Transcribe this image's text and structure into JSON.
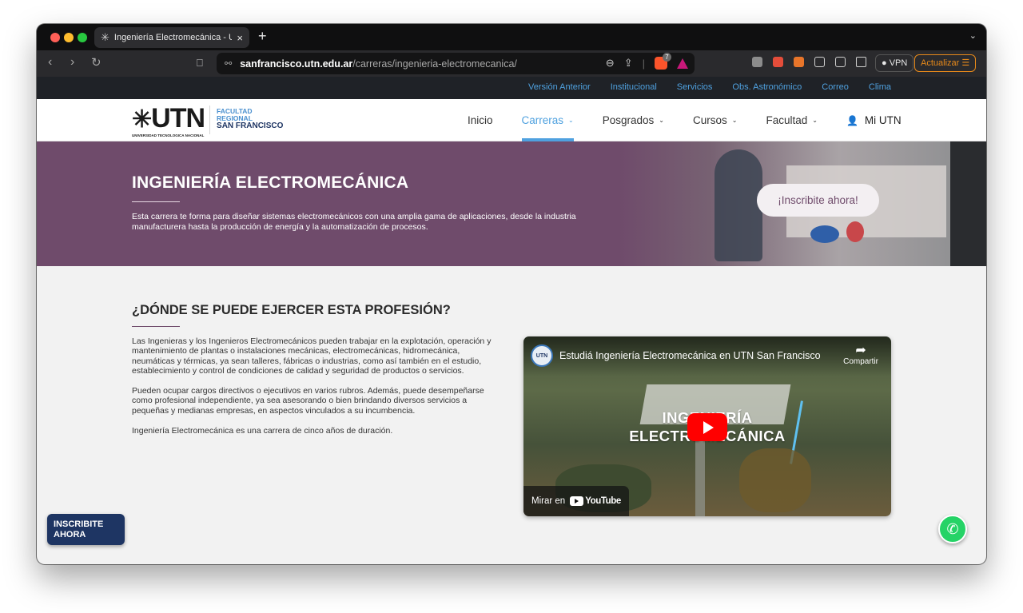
{
  "browser": {
    "tab_title": "Ingeniería Electromecánica - U",
    "tab_close": "×",
    "new_tab": "+",
    "tab_menu": "⌄",
    "back": "‹",
    "forward": "›",
    "reload": "↻",
    "url_host": "sanfrancisco.utn.edu.ar",
    "url_path": "/carreras/ingenieria-electromecanica/",
    "brave_badge": "7",
    "vpn_label": "VPN",
    "update_label": "Actualizar ☰"
  },
  "top_links": [
    "Versión Anterior",
    "Institucional",
    "Servicios",
    "Obs. Astronómico",
    "Correo",
    "Clima"
  ],
  "logo": {
    "wordmark": "UTN",
    "tagline": "UNIVERSIDAD TECNOLOGICA NACIONAL",
    "line1": "FACULTAD",
    "line2": "REGIONAL",
    "line3": "SAN FRANCISCO"
  },
  "nav": {
    "inicio": "Inicio",
    "carreras": "Carreras",
    "posgrados": "Posgrados",
    "cursos": "Cursos",
    "facultad": "Facultad",
    "mi_utn": "Mi UTN",
    "chevron": "⌄"
  },
  "hero": {
    "title": "INGENIERÍA ELECTROMECÁNICA",
    "text": "Esta carrera te forma para diseñar sistemas electromecánicos con una amplia gama de aplicaciones, desde la industria manufacturera hasta la producción de energía y la automatización de procesos.",
    "cta": "¡Inscribite ahora!"
  },
  "section": {
    "title": "¿DÓNDE SE PUEDE EJERCER ESTA PROFESIÓN?",
    "p1": "Las Ingenieras y los Ingenieros Electromecánicos pueden trabajar en la explotación, operación y mantenimiento de plantas o instalaciones mecánicas, electromecánicas, hidromecánica, neumáticas y térmicas, ya sean talleres, fábricas o industrias, como así también en el estudio, establecimiento y control de condiciones de calidad y seguridad de productos o servicios.",
    "p2": "Pueden ocupar cargos directivos o ejecutivos en varios rubros. Además, puede desempeñarse como profesional independiente, ya sea asesorando o bien brindando diversos servicios a pequeñas y medianas empresas, en aspectos vinculados a su incumbencia.",
    "p3": "Ingeniería Electromecánica es una carrera de cinco años de duración."
  },
  "video": {
    "channel_avatar": "UTN",
    "title": "Estudiá Ingeniería Electromecánica en UTN San Francisco",
    "share": "Compartir",
    "big_line1": "INGENIERÍA",
    "big_line2": "ELECTROMECÁNICA",
    "watch_on": "Mirar en",
    "yt": "YouTube"
  },
  "floating": {
    "inscribite": "INSCRIBITE AHORA"
  },
  "colors": {
    "hero": "#6f4b6b",
    "accent": "#4fa1df",
    "navy": "#1e3563",
    "whatsapp": "#25d366"
  }
}
